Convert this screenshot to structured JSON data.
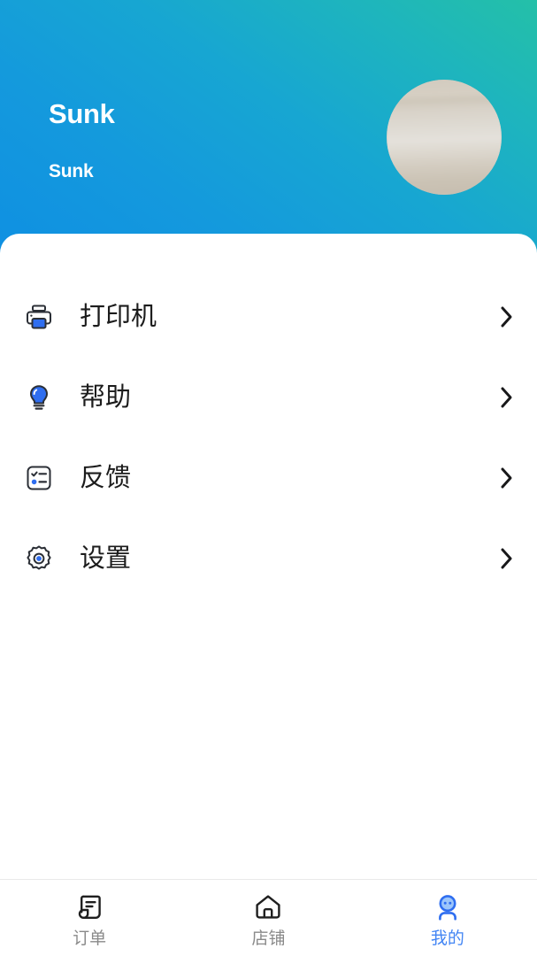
{
  "header": {
    "name": "Sunk",
    "subtitle": "Sunk",
    "avatar_icon": "avatar-photo",
    "gradient_start": "#0f90e2",
    "gradient_end": "#24c0a8"
  },
  "menu": {
    "items": [
      {
        "label": "打印机",
        "icon": "printer-icon",
        "chevron": "›"
      },
      {
        "label": "帮助",
        "icon": "lightbulb-icon",
        "chevron": "›"
      },
      {
        "label": "反馈",
        "icon": "checklist-icon",
        "chevron": "›"
      },
      {
        "label": "设置",
        "icon": "gear-icon",
        "chevron": "›"
      }
    ]
  },
  "tabbar": {
    "active_color": "#4285f4",
    "inactive_color": "#8a8a8a",
    "items": [
      {
        "label": "订单",
        "icon": "receipt-icon",
        "active": false
      },
      {
        "label": "店铺",
        "icon": "home-icon",
        "active": false
      },
      {
        "label": "我的",
        "icon": "profile-icon",
        "active": true
      }
    ]
  }
}
